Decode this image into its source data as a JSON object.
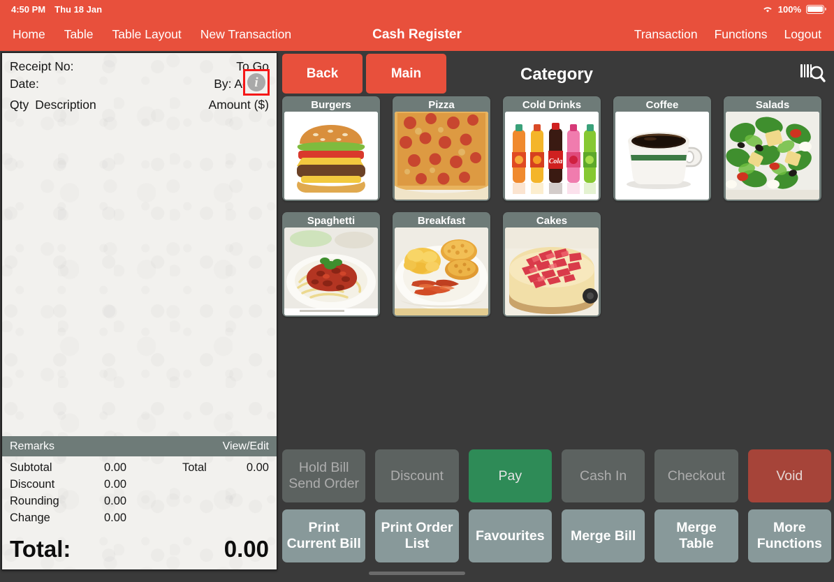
{
  "statusbar": {
    "time": "4:50 PM",
    "date": "Thu 18 Jan",
    "battery_percent": "100%",
    "wifi_icon": "wifi-icon",
    "battery_icon": "battery-full-icon"
  },
  "navbar": {
    "title": "Cash Register",
    "left_items": [
      {
        "label": "Home",
        "name": "nav-home"
      },
      {
        "label": "Table",
        "name": "nav-table"
      },
      {
        "label": "Table Layout",
        "name": "nav-table-layout"
      },
      {
        "label": "New Transaction",
        "name": "nav-new-transaction"
      }
    ],
    "right_items": [
      {
        "label": "Transaction",
        "name": "nav-transaction"
      },
      {
        "label": "Functions",
        "name": "nav-functions"
      },
      {
        "label": "Logout",
        "name": "nav-logout"
      }
    ]
  },
  "receipt": {
    "receipt_no_label": "Receipt No:",
    "receipt_no_value": "",
    "order_type": "To Go",
    "date_label": "Date:",
    "date_value": "",
    "by_label": "By: Admin",
    "info_icon": "info-icon",
    "col_qty": "Qty",
    "col_description": "Description",
    "col_amount": "Amount ($)",
    "items": [],
    "remarks_label": "Remarks",
    "remarks_action": "View/Edit",
    "totals": [
      {
        "label": "Subtotal",
        "value": "0.00"
      },
      {
        "label": "Discount",
        "value": "0.00"
      },
      {
        "label": "Rounding",
        "value": "0.00"
      },
      {
        "label": "Change",
        "value": "0.00"
      }
    ],
    "total_side_label": "Total",
    "total_side_value": "0.00",
    "grand_total_label": "Total:",
    "grand_total_value": "0.00"
  },
  "right_pane": {
    "back_label": "Back",
    "main_label": "Main",
    "title": "Category",
    "scan_icon": "barcode-scan-icon",
    "categories": [
      {
        "label": "Burgers",
        "image": "burger-image"
      },
      {
        "label": "Pizza",
        "image": "pizza-image"
      },
      {
        "label": "Cold Drinks",
        "image": "soda-bottles-image"
      },
      {
        "label": "Coffee",
        "image": "coffee-cup-image"
      },
      {
        "label": "Salads",
        "image": "salad-bowl-image"
      },
      {
        "label": "Spaghetti",
        "image": "spaghetti-plate-image"
      },
      {
        "label": "Breakfast",
        "image": "breakfast-plate-image"
      },
      {
        "label": "Cakes",
        "image": "strawberry-cheesecake-image"
      }
    ]
  },
  "actions": {
    "row1": [
      {
        "label": "Hold Bill\nSend Order",
        "style": "disabled",
        "name": "hold-bill-send-order-button"
      },
      {
        "label": "Discount",
        "style": "disabled",
        "name": "discount-button"
      },
      {
        "label": "Pay",
        "style": "pay",
        "name": "pay-button"
      },
      {
        "label": "Cash In",
        "style": "disabled",
        "name": "cash-in-button"
      },
      {
        "label": "Checkout",
        "style": "disabled",
        "name": "checkout-button"
      },
      {
        "label": "Void",
        "style": "void",
        "name": "void-button"
      }
    ],
    "row2": [
      {
        "label": "Print\nCurrent Bill",
        "style": "light",
        "name": "print-current-bill-button"
      },
      {
        "label": "Print Order\nList",
        "style": "light",
        "name": "print-order-list-button"
      },
      {
        "label": "Favourites",
        "style": "light",
        "name": "favourites-button"
      },
      {
        "label": "Merge Bill",
        "style": "light",
        "name": "merge-bill-button"
      },
      {
        "label": "Merge Table",
        "style": "light",
        "name": "merge-table-button"
      },
      {
        "label": "More\nFunctions",
        "style": "light",
        "name": "more-functions-button"
      }
    ]
  },
  "colors": {
    "brand_red": "#e8503c",
    "pay_green": "#2e8b57",
    "void_red": "#a64439",
    "tile_gray": "#6e7b78",
    "light_button": "#88999a",
    "background": "#3a3a3a",
    "highlight_box": "#f51818"
  }
}
